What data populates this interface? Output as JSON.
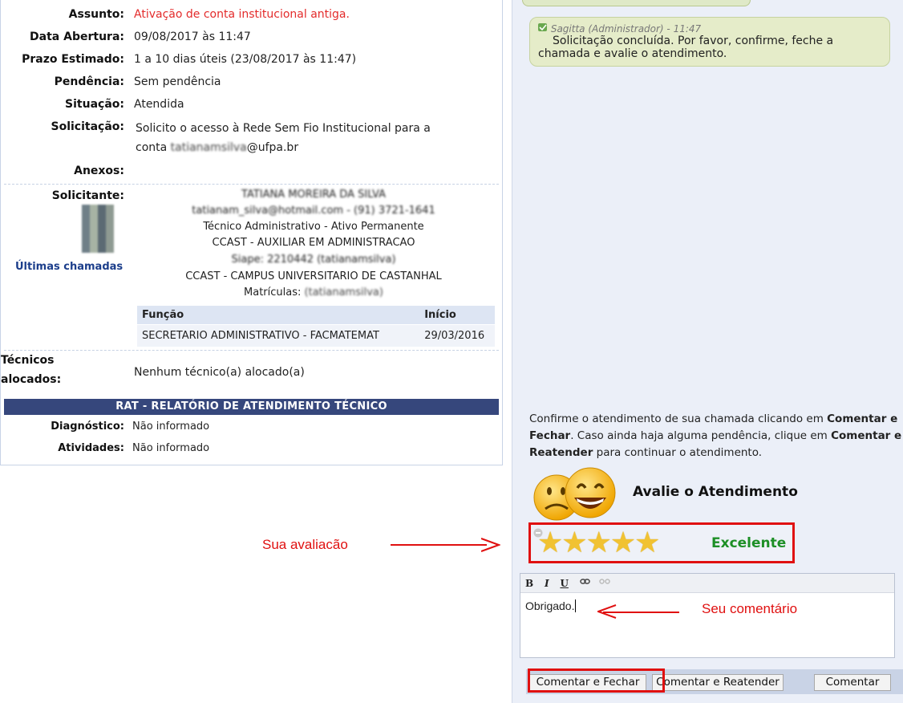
{
  "details": {
    "assunto_label": "Assunto:",
    "assunto_value": "Ativação de conta institucional antiga.",
    "data_label": "Data Abertura:",
    "data_value": "09/08/2017 às 11:47",
    "prazo_label": "Prazo Estimado:",
    "prazo_value": "1 a 10 dias úteis (23/08/2017 às 11:47)",
    "pendencia_label": "Pendência:",
    "pendencia_value": "Sem pendência",
    "situacao_label": "Situação:",
    "situacao_value": "Atendida",
    "solicitacao_label": "Solicitação:",
    "solicitacao_line1": "Solicito o acesso à Rede Sem Fio Institucional para a",
    "solicitacao_line2_prefix": "conta ",
    "solicitacao_line2_blur": "tatianamsilva",
    "solicitacao_line2_suffix": "@ufpa.br",
    "anexos_label": "Anexos:"
  },
  "solicitante": {
    "label": "Solicitante:",
    "name": "TATIANA MOREIRA DA SILVA",
    "contact": "tatianam_silva@hotmail.com - (91) 3721-1641",
    "role": "Técnico Administrativo - Ativo Permanente",
    "unit": "CCAST - AUXILIAR EM ADMINISTRACAO",
    "siape": "Siape: 2210442 (tatianamsilva)",
    "campus": "CCAST - CAMPUS UNIVERSITARIO DE CASTANHAL",
    "matriculas_label": "Matrículas: ",
    "matriculas_value": "(tatianamsilva)",
    "last_calls_link": "Últimas chamadas",
    "table": {
      "headers": [
        "Função",
        "Início"
      ],
      "rows": [
        [
          "SECRETARIO ADMINISTRATIVO - FACMATEMAT",
          "29/03/2016"
        ]
      ]
    }
  },
  "tecnicos": {
    "label_line1": "Técnicos",
    "label_line2": "alocados:",
    "value": "Nenhum técnico(a) alocado(a)"
  },
  "rat": {
    "header": "RAT - RELATÓRIO DE ATENDIMENTO TÉCNICO",
    "diagnostico_label": "Diagnóstico:",
    "diagnostico_value": "Não informado",
    "atividades_label": "Atividades:",
    "atividades_value": "Não informado"
  },
  "chat": {
    "meta": "Sagitta (Administrador) - 11:47",
    "text_line1": "Solicitação concluída. Por favor, confirme, feche a",
    "text_line2": "chamada e avalie o atendimento."
  },
  "confirm": {
    "part1": "Confirme o atendimento de sua chamada clicando em ",
    "bold1": "Comentar e Fechar",
    "part2": ". Caso ainda haja alguma pendência, clique em ",
    "bold2": "Comentar e Reatender",
    "part3": " para continuar o atendimento."
  },
  "rating": {
    "title": "Avalie o Atendimento",
    "stars": 5,
    "max_stars": 5,
    "label": "Excelente",
    "label_color": "#1d8f26"
  },
  "editor": {
    "bold": "B",
    "italic": "I",
    "underline": "U",
    "text": "Obrigado."
  },
  "buttons": {
    "close": "Comentar e Fechar",
    "reopen": "Comentar e Reatender",
    "comment": "Comentar"
  },
  "annotations": {
    "rating_note": "Sua avaliacão",
    "comment_note": "Seu comentário"
  },
  "colors": {
    "accent_red": "#e01010",
    "header_blue": "#36477c",
    "link_blue": "#1c3e8b",
    "subject_red": "#e32b2b"
  }
}
